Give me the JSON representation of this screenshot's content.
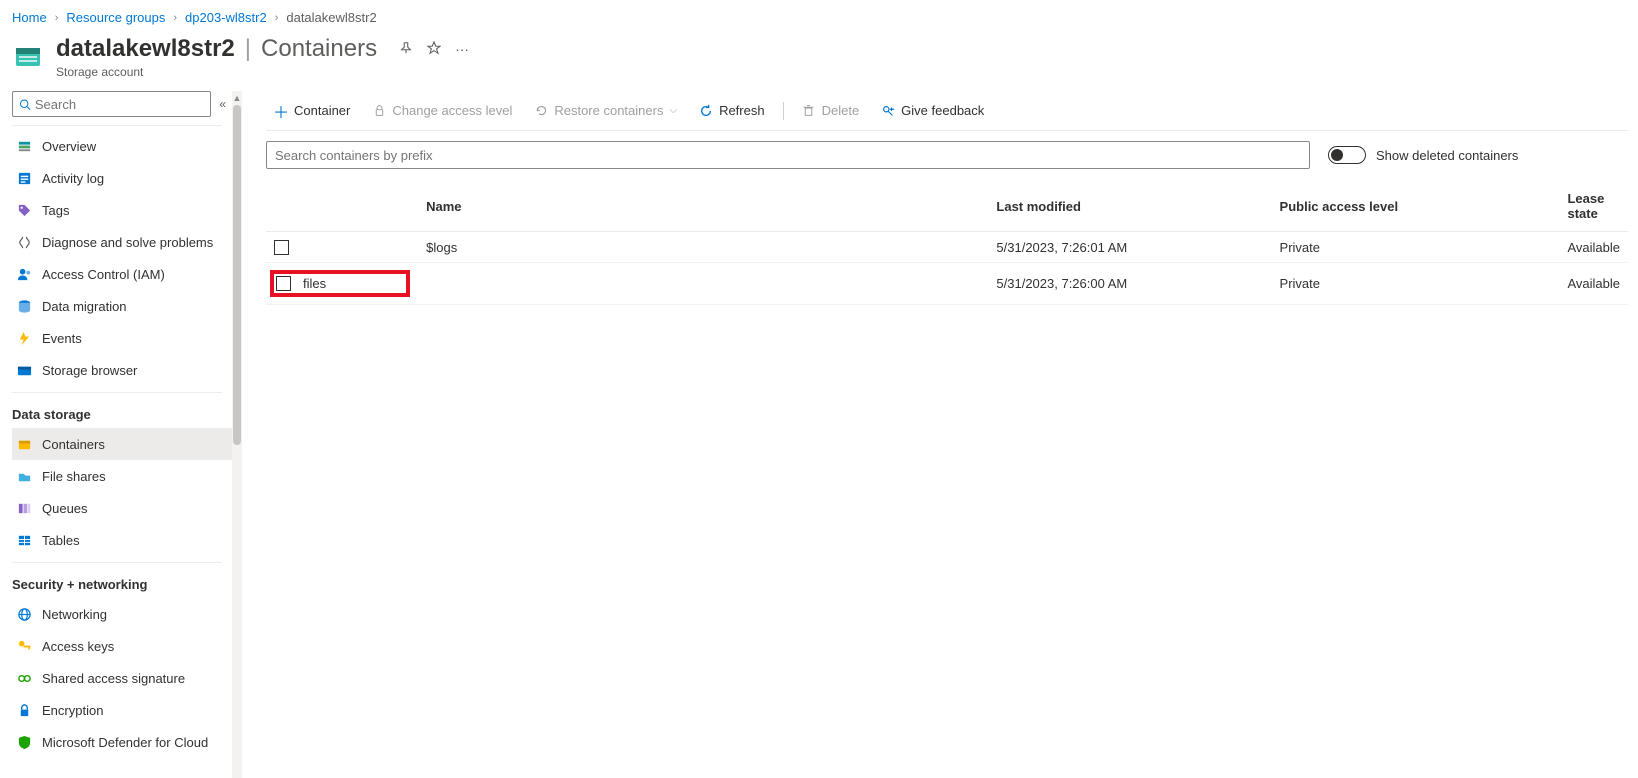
{
  "breadcrumb": {
    "items": [
      "Home",
      "Resource groups",
      "dp203-wl8str2"
    ],
    "current": "datalakewl8str2"
  },
  "header": {
    "title": "datalakewl8str2",
    "page": "Containers",
    "subtitle": "Storage account"
  },
  "sidebar": {
    "search_placeholder": "Search",
    "items_top": [
      {
        "label": "Overview",
        "icon": "overview"
      },
      {
        "label": "Activity log",
        "icon": "activity"
      },
      {
        "label": "Tags",
        "icon": "tags"
      },
      {
        "label": "Diagnose and solve problems",
        "icon": "diagnose"
      },
      {
        "label": "Access Control (IAM)",
        "icon": "iam"
      },
      {
        "label": "Data migration",
        "icon": "migration"
      },
      {
        "label": "Events",
        "icon": "events"
      },
      {
        "label": "Storage browser",
        "icon": "browser"
      }
    ],
    "section_storage": "Data storage",
    "items_storage": [
      {
        "label": "Containers",
        "icon": "containers",
        "active": true
      },
      {
        "label": "File shares",
        "icon": "fileshares"
      },
      {
        "label": "Queues",
        "icon": "queues"
      },
      {
        "label": "Tables",
        "icon": "tables"
      }
    ],
    "section_security": "Security + networking",
    "items_security": [
      {
        "label": "Networking",
        "icon": "networking"
      },
      {
        "label": "Access keys",
        "icon": "keys"
      },
      {
        "label": "Shared access signature",
        "icon": "sas"
      },
      {
        "label": "Encryption",
        "icon": "encryption"
      },
      {
        "label": "Microsoft Defender for Cloud",
        "icon": "defender"
      }
    ]
  },
  "toolbar": {
    "container": "Container",
    "change_access": "Change access level",
    "restore": "Restore containers",
    "refresh": "Refresh",
    "delete": "Delete",
    "feedback": "Give feedback"
  },
  "grid": {
    "search_placeholder": "Search containers by prefix",
    "toggle_label": "Show deleted containers",
    "columns": {
      "name": "Name",
      "last_modified": "Last modified",
      "public_access": "Public access level",
      "lease_state": "Lease state"
    },
    "rows": [
      {
        "name": "$logs",
        "last_modified": "5/31/2023, 7:26:01 AM",
        "public_access": "Private",
        "lease_state": "Available",
        "highlight": false
      },
      {
        "name": "files",
        "last_modified": "5/31/2023, 7:26:00 AM",
        "public_access": "Private",
        "lease_state": "Available",
        "highlight": true
      }
    ]
  },
  "colors": {
    "link": "#0078d4",
    "highlight": "#e81123"
  }
}
